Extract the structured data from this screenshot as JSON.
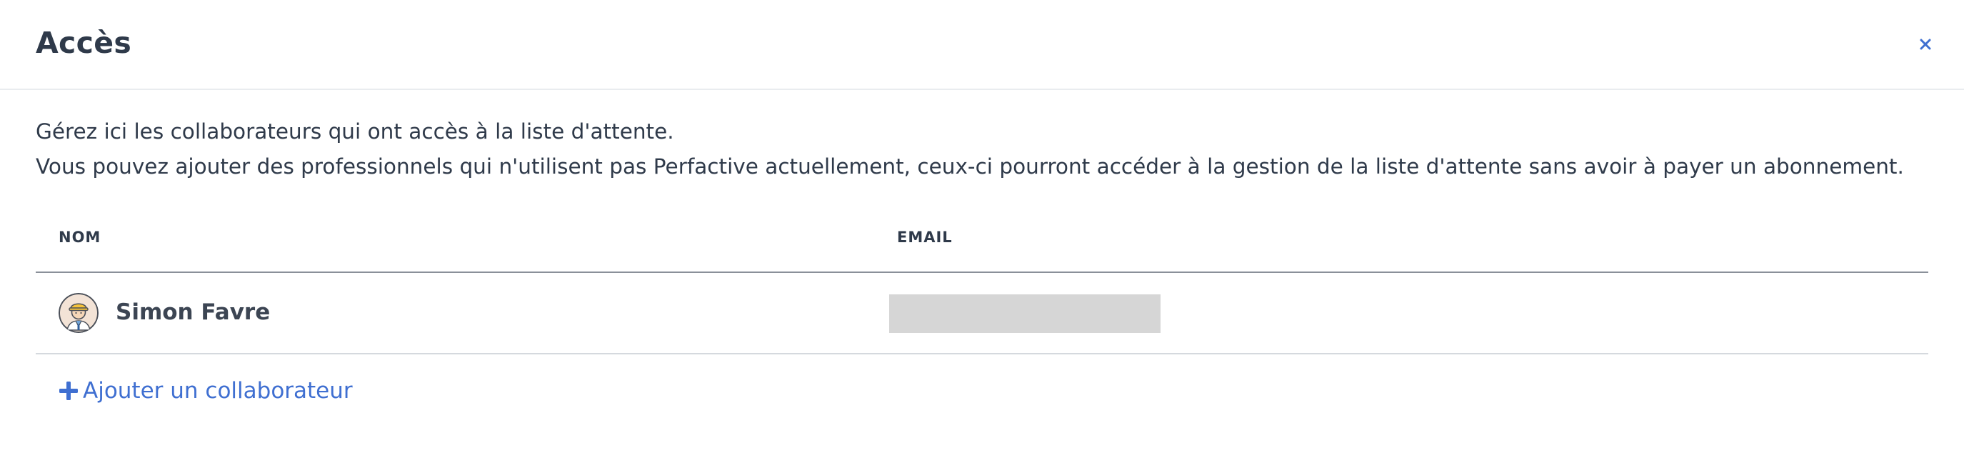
{
  "modal": {
    "title": "Accès",
    "close_icon": "close-icon",
    "accent_color": "#3f6fd1"
  },
  "intro": {
    "line1": "Gérez ici les collaborateurs qui ont accès à la liste d'attente.",
    "line2": "Vous pouvez ajouter des professionnels qui n'utilisent pas Perfactive actuellement, ceux-ci pourront accéder à la gestion de la liste d'attente sans avoir à payer un abonnement."
  },
  "table": {
    "columns": [
      "NOM",
      "EMAIL"
    ],
    "rows": [
      {
        "avatar_icon": "user-avatar-icon",
        "name": "Simon Favre",
        "email": ""
      }
    ]
  },
  "actions": {
    "add_icon": "plus-icon",
    "add_label": "Ajouter un collaborateur"
  }
}
